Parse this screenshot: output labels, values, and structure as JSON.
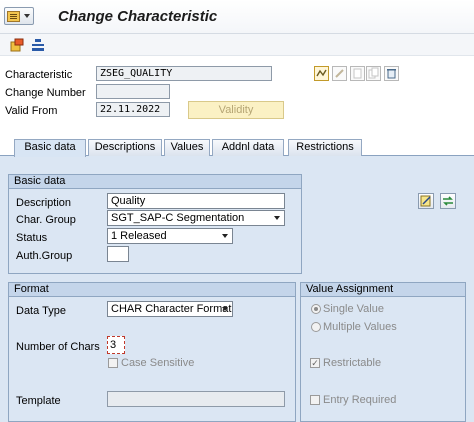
{
  "window": {
    "title": "Change Characteristic"
  },
  "toolbar": {
    "icons": [
      "other-object-icon",
      "hierarchy-icon"
    ]
  },
  "header": {
    "characteristic_label": "Characteristic",
    "characteristic_value": "ZSEG_QUALITY",
    "change_number_label": "Change Number",
    "change_number_value": "",
    "valid_from_label": "Valid From",
    "valid_from_value": "22.11.2022",
    "validity_button": "Validity",
    "action_icons": [
      "display-change-icon",
      "edit-icon",
      "create-icon",
      "copy-icon",
      "delete-icon"
    ]
  },
  "tabs": [
    {
      "label": "Basic data",
      "active": true
    },
    {
      "label": "Descriptions",
      "active": false
    },
    {
      "label": "Values",
      "active": false
    },
    {
      "label": "Addnl data",
      "active": false
    },
    {
      "label": "Restrictions",
      "active": false
    }
  ],
  "basic_data": {
    "title": "Basic data",
    "description_label": "Description",
    "description_value": "Quality",
    "char_group_label": "Char. Group",
    "char_group_value": "SGT_SAP-C Segmentation",
    "status_label": "Status",
    "status_value": "1 Released",
    "auth_group_label": "Auth.Group",
    "auth_group_value": ""
  },
  "format": {
    "title": "Format",
    "data_type_label": "Data Type",
    "data_type_value": "CHAR Character Format",
    "num_chars_label": "Number of Chars",
    "num_chars_value": "3",
    "case_sensitive_label": "Case Sensitive",
    "case_sensitive_checked": false,
    "template_label": "Template",
    "template_value": ""
  },
  "value_assignment": {
    "title": "Value Assignment",
    "single_value_label": "Single Value",
    "single_value_selected": true,
    "multiple_values_label": "Multiple Values",
    "multiple_values_selected": false,
    "restrictable_label": "Restrictable",
    "restrictable_checked": true,
    "entry_required_label": "Entry Required",
    "entry_required_checked": false
  },
  "colors": {
    "panel_bg": "#dbe6f3",
    "group_header": "#c4d5ea",
    "validity_button": "#fbf1c4"
  }
}
